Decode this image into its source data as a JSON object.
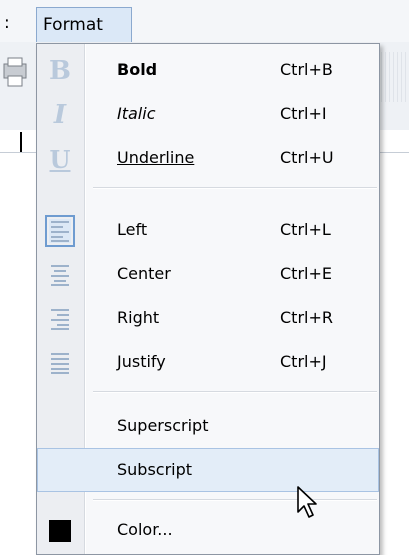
{
  "menubar": {
    "prev_menu_fragment": ":",
    "format_label": "Format"
  },
  "menu": {
    "items": [
      {
        "label": "Bold",
        "shortcut": "Ctrl+B",
        "icon": "bold-icon"
      },
      {
        "label": "Italic",
        "shortcut": "Ctrl+I",
        "icon": "italic-icon"
      },
      {
        "label": "Underline",
        "shortcut": "Ctrl+U",
        "icon": "underline-icon"
      },
      {
        "label": "Left",
        "shortcut": "Ctrl+L",
        "icon": "align-left-icon",
        "checked": true
      },
      {
        "label": "Center",
        "shortcut": "Ctrl+E",
        "icon": "align-center-icon"
      },
      {
        "label": "Right",
        "shortcut": "Ctrl+R",
        "icon": "align-right-icon"
      },
      {
        "label": "Justify",
        "shortcut": "Ctrl+J",
        "icon": "align-justify-icon"
      },
      {
        "label": "Superscript",
        "shortcut": ""
      },
      {
        "label": "Subscript",
        "shortcut": "",
        "highlighted": true
      },
      {
        "label": "Color...",
        "shortcut": "",
        "icon": "color-swatch-icon"
      }
    ],
    "icon_glyphs": {
      "bold": "B",
      "italic": "I",
      "underline": "U"
    },
    "colors": {
      "highlight_bg": "#e3edf8",
      "highlight_border": "#a9c3e3",
      "icon_tint": "#9db2cb",
      "color_swatch": "#000000"
    }
  }
}
